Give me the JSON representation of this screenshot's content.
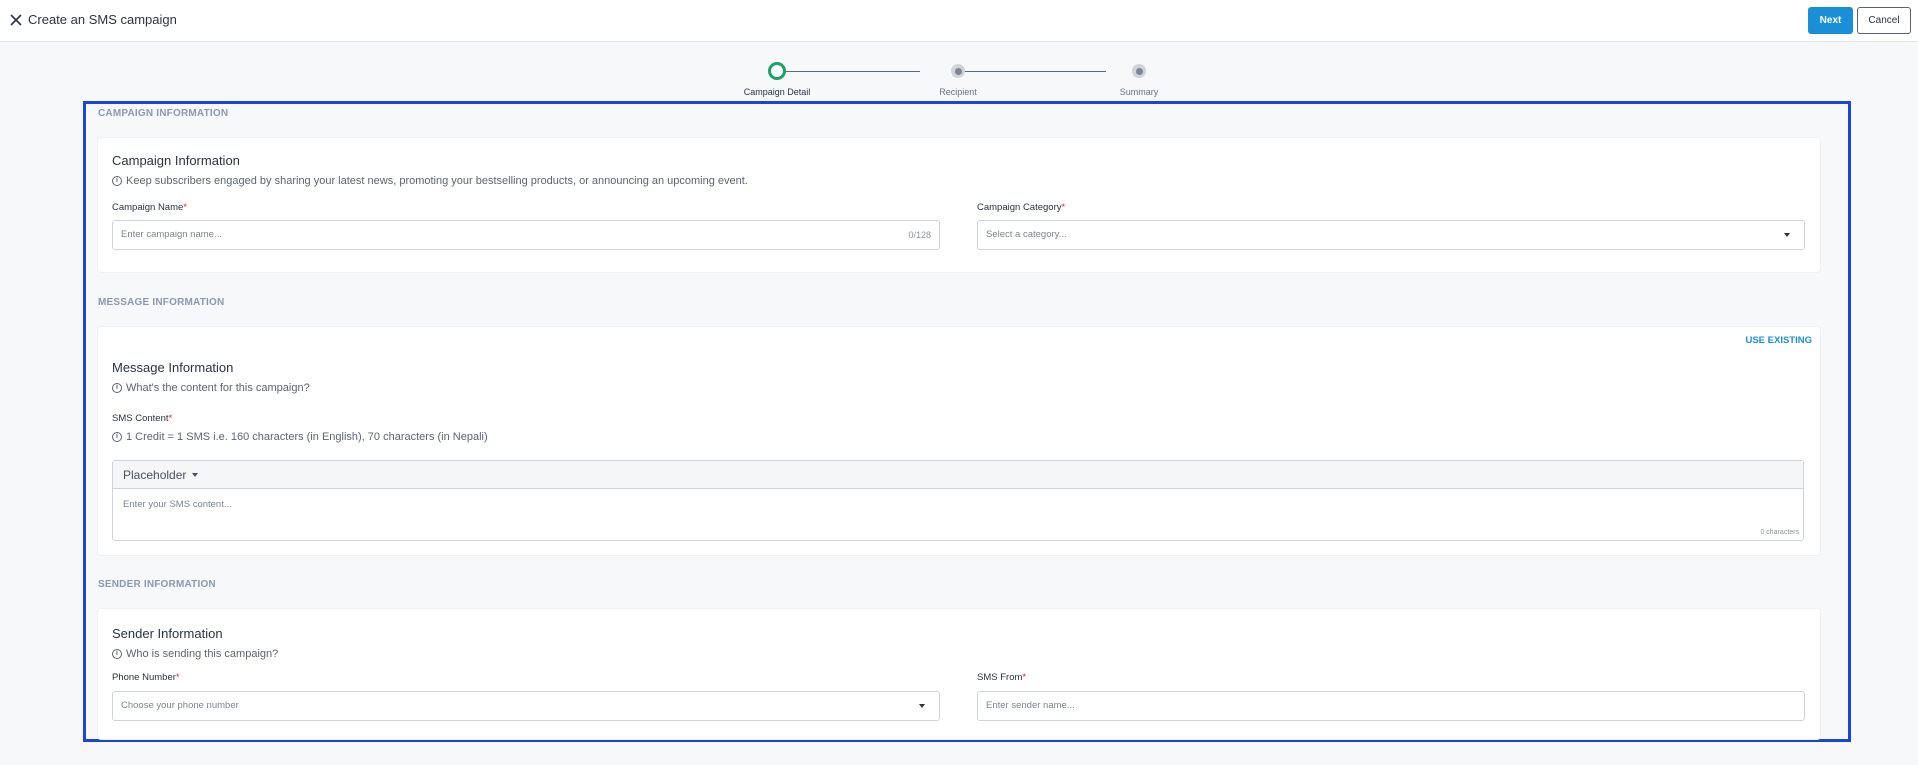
{
  "header": {
    "title": "Create an SMS campaign",
    "next_label": "Next",
    "cancel_label": "Cancel"
  },
  "stepper": {
    "steps": [
      {
        "label": "Campaign Detail",
        "active": true
      },
      {
        "label": "Recipient",
        "active": false
      },
      {
        "label": "Summary",
        "active": false
      }
    ]
  },
  "campaign": {
    "section_title": "CAMPAIGN INFORMATION",
    "title": "Campaign Information",
    "subtitle": "Keep subscribers engaged by sharing your latest news, promoting your bestselling products, or announcing an upcoming event.",
    "name_label": "Campaign Name",
    "name_placeholder": "Enter campaign name...",
    "name_counter": "0/128",
    "category_label": "Campaign Category",
    "category_placeholder": "Select a category..."
  },
  "message": {
    "section_title": "MESSAGE INFORMATION",
    "use_existing": "USE EXISTING",
    "title": "Message Information",
    "subtitle": "What's the content for this campaign?",
    "sms_label": "SMS Content",
    "sms_hint": "1 Credit = 1 SMS i.e. 160 characters (in English), 70 characters (in Nepali)",
    "placeholder_dropdown": "Placeholder",
    "content_placeholder": "Enter your SMS content...",
    "char_count": "0 characters"
  },
  "sender": {
    "section_title": "SENDER INFORMATION",
    "title": "Sender Information",
    "subtitle": "Who is sending this campaign?",
    "phone_label": "Phone Number",
    "phone_placeholder": "Choose your phone number",
    "from_label": "SMS From",
    "from_placeholder": "Enter sender name..."
  },
  "required_mark": "*",
  "info_glyph": "i",
  "colors": {
    "primary": "#1a8fd8",
    "active_step": "#1aa267",
    "required": "#d7263d",
    "highlight_frame": "#1b44d8"
  }
}
